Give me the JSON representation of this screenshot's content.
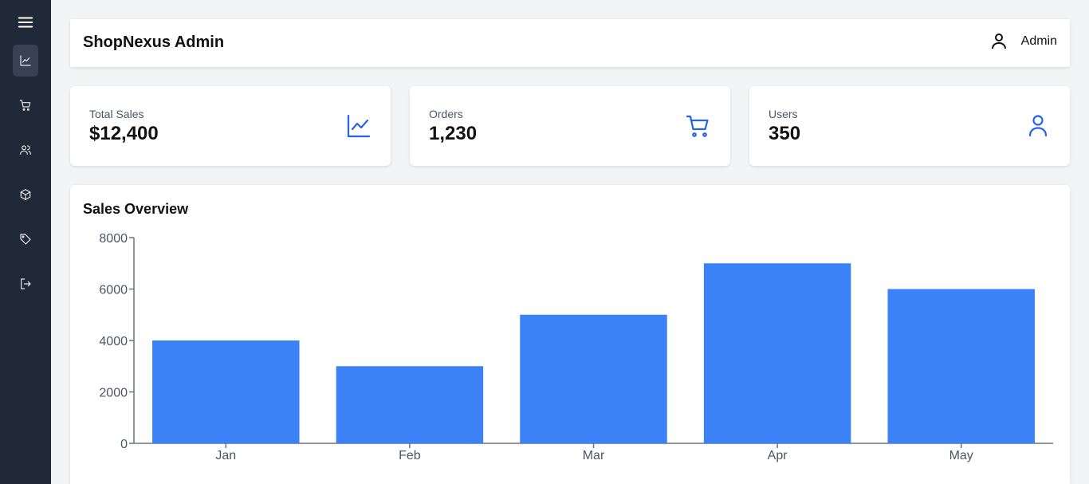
{
  "sidebar": {
    "items": [
      {
        "name": "menu-icon",
        "active": false
      },
      {
        "name": "chart-line-icon",
        "active": true
      },
      {
        "name": "shopping-cart-icon",
        "active": false
      },
      {
        "name": "users-icon",
        "active": false
      },
      {
        "name": "box-icon",
        "active": false
      },
      {
        "name": "tag-icon",
        "active": false
      },
      {
        "name": "logout-icon",
        "active": false
      }
    ]
  },
  "header": {
    "title": "ShopNexus Admin",
    "user_label": "Admin",
    "user_icon": "user-icon"
  },
  "stats": [
    {
      "label": "Total Sales",
      "value": "$12,400",
      "icon": "chart-line-icon"
    },
    {
      "label": "Orders",
      "value": "1,230",
      "icon": "shopping-cart-icon"
    },
    {
      "label": "Users",
      "value": "350",
      "icon": "user-icon"
    }
  ],
  "colors": {
    "accent": "#2563eb",
    "bar": "#3b82f6",
    "sidebar_bg": "#1f2937"
  },
  "chart_panel": {
    "title": "Sales Overview"
  },
  "chart_data": {
    "type": "bar",
    "title": "Sales Overview",
    "categories": [
      "Jan",
      "Feb",
      "Mar",
      "Apr",
      "May"
    ],
    "values": [
      4000,
      3000,
      5000,
      7000,
      6000
    ],
    "yticks": [
      0,
      2000,
      4000,
      6000,
      8000
    ],
    "ylim": [
      0,
      8000
    ],
    "xlabel": "",
    "ylabel": "",
    "grid": false,
    "legend": "none"
  }
}
